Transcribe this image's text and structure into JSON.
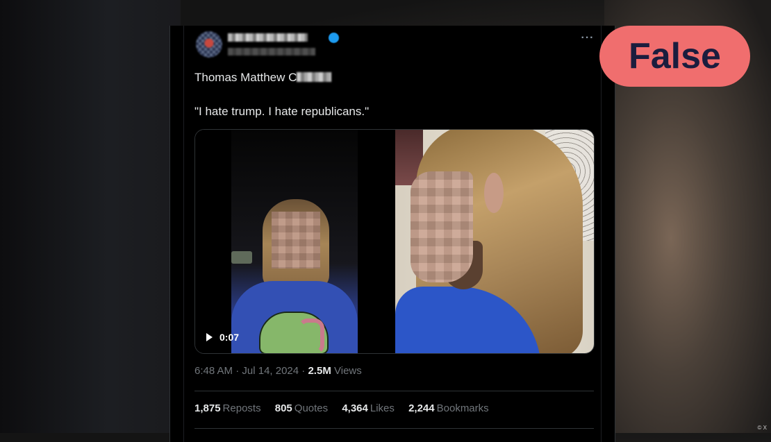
{
  "tweet": {
    "more_icon": "more-horizontal-icon",
    "text_line1_visible": "Thomas Matthew C",
    "text_line2": "\"I hate trump. I hate republicans.\"",
    "video": {
      "play_icon": "play-icon",
      "duration": "0:07"
    },
    "meta": {
      "time": "6:48 AM",
      "date": "Jul 14, 2024",
      "views_count": "2.5M",
      "views_label": "Views"
    },
    "engagement": {
      "reposts_count": "1,875",
      "reposts_label": "Reposts",
      "quotes_count": "805",
      "quotes_label": "Quotes",
      "likes_count": "4,364",
      "likes_label": "Likes",
      "bookmarks_count": "2,244",
      "bookmarks_label": "Bookmarks"
    }
  },
  "verdict": {
    "label": "False",
    "color": "#f06e6e"
  },
  "credit": "© X"
}
